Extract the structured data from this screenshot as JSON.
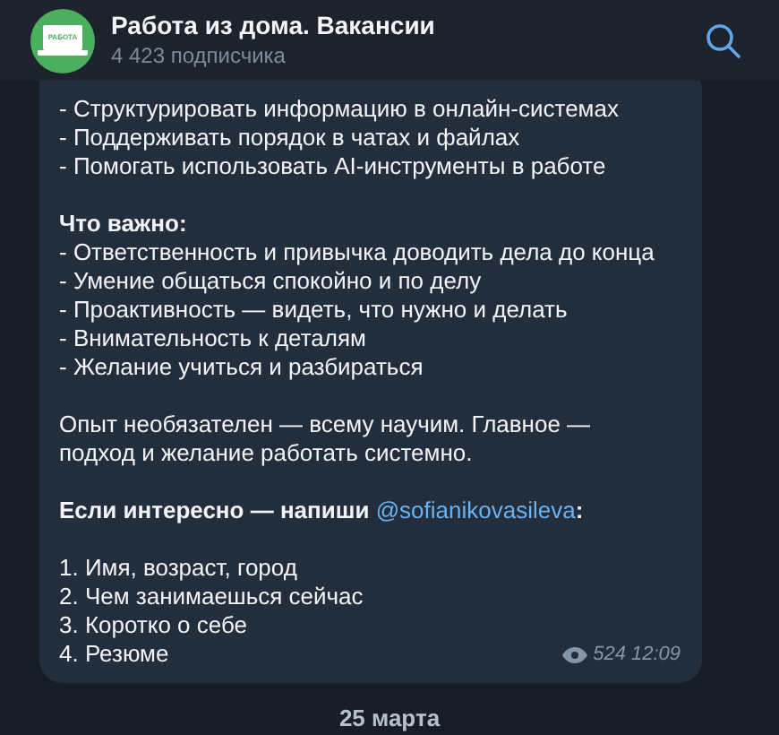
{
  "header": {
    "avatar_label": "РАБОТА",
    "title": "Работа из дома. Вакансии",
    "subtitle": "4 423 подписчика"
  },
  "message": {
    "blocks": [
      {
        "kind": "list",
        "lines": [
          "- Структурировать информацию в онлайн-системах",
          "- Поддерживать порядок в чатах и файлах",
          "- Помогать использовать AI-инструменты в работе"
        ]
      },
      {
        "kind": "section",
        "heading": "Что важно:",
        "lines": [
          "- Ответственность и привычка доводить дела до конца",
          "- Умение общаться спокойно и по делу",
          "- Проактивность — видеть, что нужно и делать",
          "- Внимательность к деталям",
          "- Желание учиться и разбираться"
        ]
      },
      {
        "kind": "paragraph",
        "text": "Опыт необязателен — всему научим. Главное — подход и желание работать системно."
      },
      {
        "kind": "contact",
        "text": "Если интересно — напиши ",
        "link": "@sofianikovasileva",
        "suffix": ":"
      },
      {
        "kind": "list",
        "lines": [
          "1. Имя, возраст, город",
          "2. Чем занимаешься сейчас",
          "3. Коротко о себе",
          "4. Резюме"
        ]
      }
    ],
    "views": "524",
    "time": "12:09"
  },
  "date_separator": "25 марта"
}
